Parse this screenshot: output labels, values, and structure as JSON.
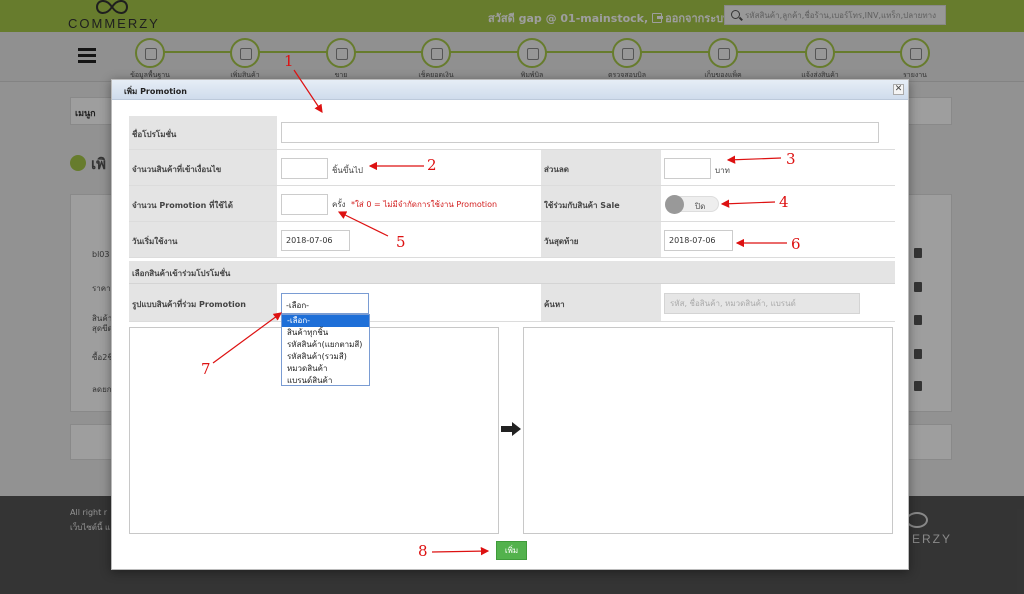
{
  "header": {
    "logo_text": "COMMERZY",
    "greeting": "สวัสดี gap @ 01-mainstock,",
    "logout_label": "ออกจากระบบ",
    "search_placeholder": "รหัสสินค้า,ลูกค้า,ชื่อร้าน,เบอร์โทร,INV,แทร็ก,ปลายทาง"
  },
  "steps": [
    {
      "label": "ข้อมูลพื้นฐาน",
      "icon": "database-icon"
    },
    {
      "label": "เพิ่มสินค้า",
      "icon": "box-icon"
    },
    {
      "label": "ขาย",
      "icon": "cash-register-icon"
    },
    {
      "label": "เช็คยอดเงิน",
      "icon": "checkmark-icon"
    },
    {
      "label": "พิมพ์บิล",
      "icon": "printer-icon"
    },
    {
      "label": "ตรวจสอบบิล",
      "icon": "scanner-icon"
    },
    {
      "label": "เก็บของแพ็ค",
      "icon": "scanner-icon"
    },
    {
      "label": "แจ้งส่งสินค้า",
      "icon": "truck-icon"
    },
    {
      "label": "รายงาน",
      "icon": "report-icon"
    }
  ],
  "background": {
    "menu_label": "เมนูก",
    "page_title": "เพิ",
    "rows": [
      "bl03",
      "ราคา",
      "สินค้า",
      "สุดขีด",
      "ซื้อ2ชิ",
      "ลดยก"
    ],
    "footer_line1": "All right r",
    "footer_line2": "เว็บไซต์นี้ แ",
    "footer_logo": "MERZY"
  },
  "modal": {
    "title": "เพิ่ม Promotion",
    "close_label": "✕",
    "promo_name_label": "ชื่อโปรโมชั่น",
    "min_items_label": "จำนวนสินค้าที่เข้าเงื่อนไข",
    "min_items_unit": "ชิ้นขึ้นไป",
    "discount_label": "ส่วนลด",
    "discount_unit": "บาท",
    "uses_label": "จำนวน Promotion ที่ใช้ได้",
    "uses_unit": "ครั้ง",
    "uses_note": "*ใส่ 0 = ไม่มีจำกัดการใช้งาน Promotion",
    "sale_label": "ใช้ร่วมกับสินค้า Sale",
    "sale_toggle": "ปิด",
    "start_label": "วันเริ่มใช้งาน",
    "start_value": "2018-07-06",
    "end_label": "วันสุดท้าย",
    "end_value": "2018-07-06",
    "section_label": "เลือกสินค้าเข้าร่วมโปรโมชั่น",
    "type_label": "รูปแบบสินค้าที่ร่วม Promotion",
    "type_selected": "-เลือก-",
    "type_options": [
      "-เลือก-",
      "สินค้าทุกชิ้น",
      "รหัสสินค้า(แยกตามสี)",
      "รหัสสินค้า(รวมสี)",
      "หมวดสินค้า",
      "แบรนด์สินค้า"
    ],
    "search_label": "ค้นหา",
    "search_placeholder": "รหัส, ชื่อสินค้า, หมวดสินค้า, แบรนด์",
    "add_button": "เพิ่ม"
  },
  "annotations": [
    "1",
    "2",
    "3",
    "4",
    "5",
    "6",
    "7",
    "8"
  ],
  "colors": {
    "brand": "#a6c84a",
    "annotation": "#dd1111",
    "add_button": "#53b24d",
    "dropdown_selected": "#1e6fd8"
  }
}
